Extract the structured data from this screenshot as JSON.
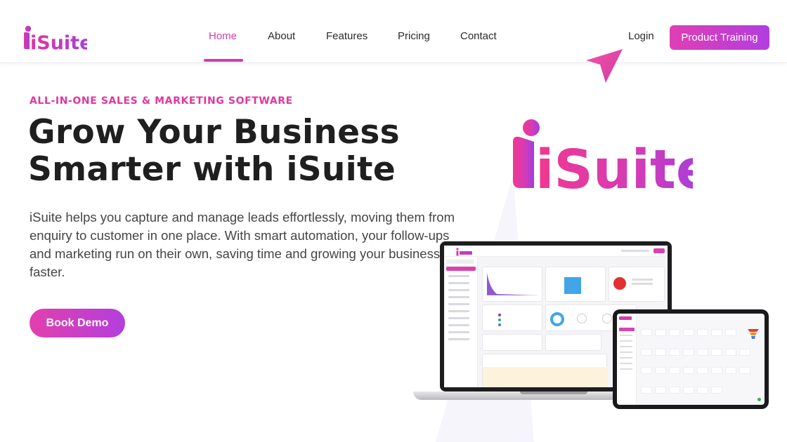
{
  "brand": {
    "name": "iSuite",
    "colors": {
      "pink": "#e0379f",
      "purple": "#b13ee0",
      "text": "#1f1f1f"
    }
  },
  "nav": {
    "links": [
      {
        "label": "Home",
        "active": true
      },
      {
        "label": "About",
        "active": false
      },
      {
        "label": "Features",
        "active": false
      },
      {
        "label": "Pricing",
        "active": false
      },
      {
        "label": "Contact",
        "active": false
      }
    ],
    "login_label": "Login",
    "cta_label": "Product Training"
  },
  "hero": {
    "eyebrow": "ALL-IN-ONE SALES & MARKETING SOFTWARE",
    "headline_line1": "Grow Your Business",
    "headline_line2": "Smarter with iSuite",
    "lead": "iSuite helps you capture and manage leads effortlessly, moving them from enquiry to customer in one place. With smart automation, your follow-ups and marketing run on their own, saving time and growing your business faster.",
    "demo_button": "Book Demo"
  },
  "icons": {
    "cursor": "pointer-arrow-icon",
    "logo_dot": "i-dot-icon"
  }
}
